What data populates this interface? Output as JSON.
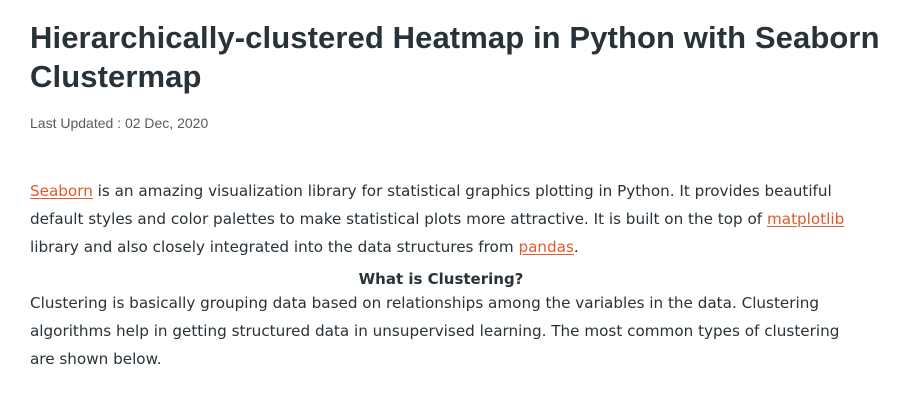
{
  "article": {
    "title": "Hierarchically-clustered Heatmap in Python with Seaborn Clustermap",
    "last_updated": "Last Updated : 02 Dec, 2020",
    "intro": {
      "link_seaborn": "Seaborn",
      "text_1": " is an amazing visualization library for statistical graphics plotting in Python. It provides beautiful default styles and color palettes to make statistical plots more attractive. It is built on the top of ",
      "link_matplotlib": "matplotlib",
      "text_2": " library and also closely integrated into the data structures from ",
      "link_pandas": "pandas",
      "text_3": "."
    },
    "section_heading": "What is Clustering?",
    "clustering_paragraph": "Clustering is basically grouping data based on relationships among the variables in the data.  Clustering algorithms help in getting structured data in unsupervised learning. The most common types of clustering are shown below."
  },
  "colors": {
    "text": "#273239",
    "muted": "#555b5f",
    "link": "#e05a2a",
    "background": "#ffffff"
  }
}
